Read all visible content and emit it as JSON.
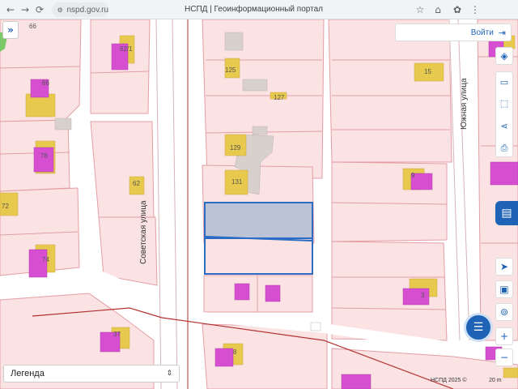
{
  "browser": {
    "url": "nspd.gov.ru",
    "page_title": "НСПД | Геоинформационный портал",
    "icons": [
      "back-icon",
      "forward-icon",
      "reload-icon",
      "home-icon",
      "site-info-icon",
      "bookmark-icon",
      "extensions-icon",
      "menu-icon"
    ]
  },
  "header": {
    "login_label": "Войти"
  },
  "map": {
    "streets": {
      "sovetskaya": "Советская улица",
      "yuzhnaya": "Южная улица"
    },
    "parcel_numbers": [
      "66",
      "62/1",
      "66",
      "78",
      "72",
      "74",
      "62",
      "125",
      "127",
      "129",
      "131",
      "15",
      "9",
      "3",
      "37",
      "8"
    ],
    "selected_parcel_color": "#2b6cc4",
    "parcel_fill_color": "#fbe3e4",
    "parcel_border_color": "#e39ea3",
    "building_color": "#e7c94e",
    "poi_color": "#d64fd1",
    "attribution": "НСПД 2025 ©",
    "scale_label": "20 m"
  },
  "legend": {
    "label": "Легенда"
  },
  "tools": [
    "layers-icon",
    "ruler-icon",
    "select-area-icon",
    "share-icon",
    "print-icon",
    "locate-icon",
    "screen-icon",
    "search-point-icon",
    "zoom-in-icon",
    "zoom-out-icon"
  ]
}
